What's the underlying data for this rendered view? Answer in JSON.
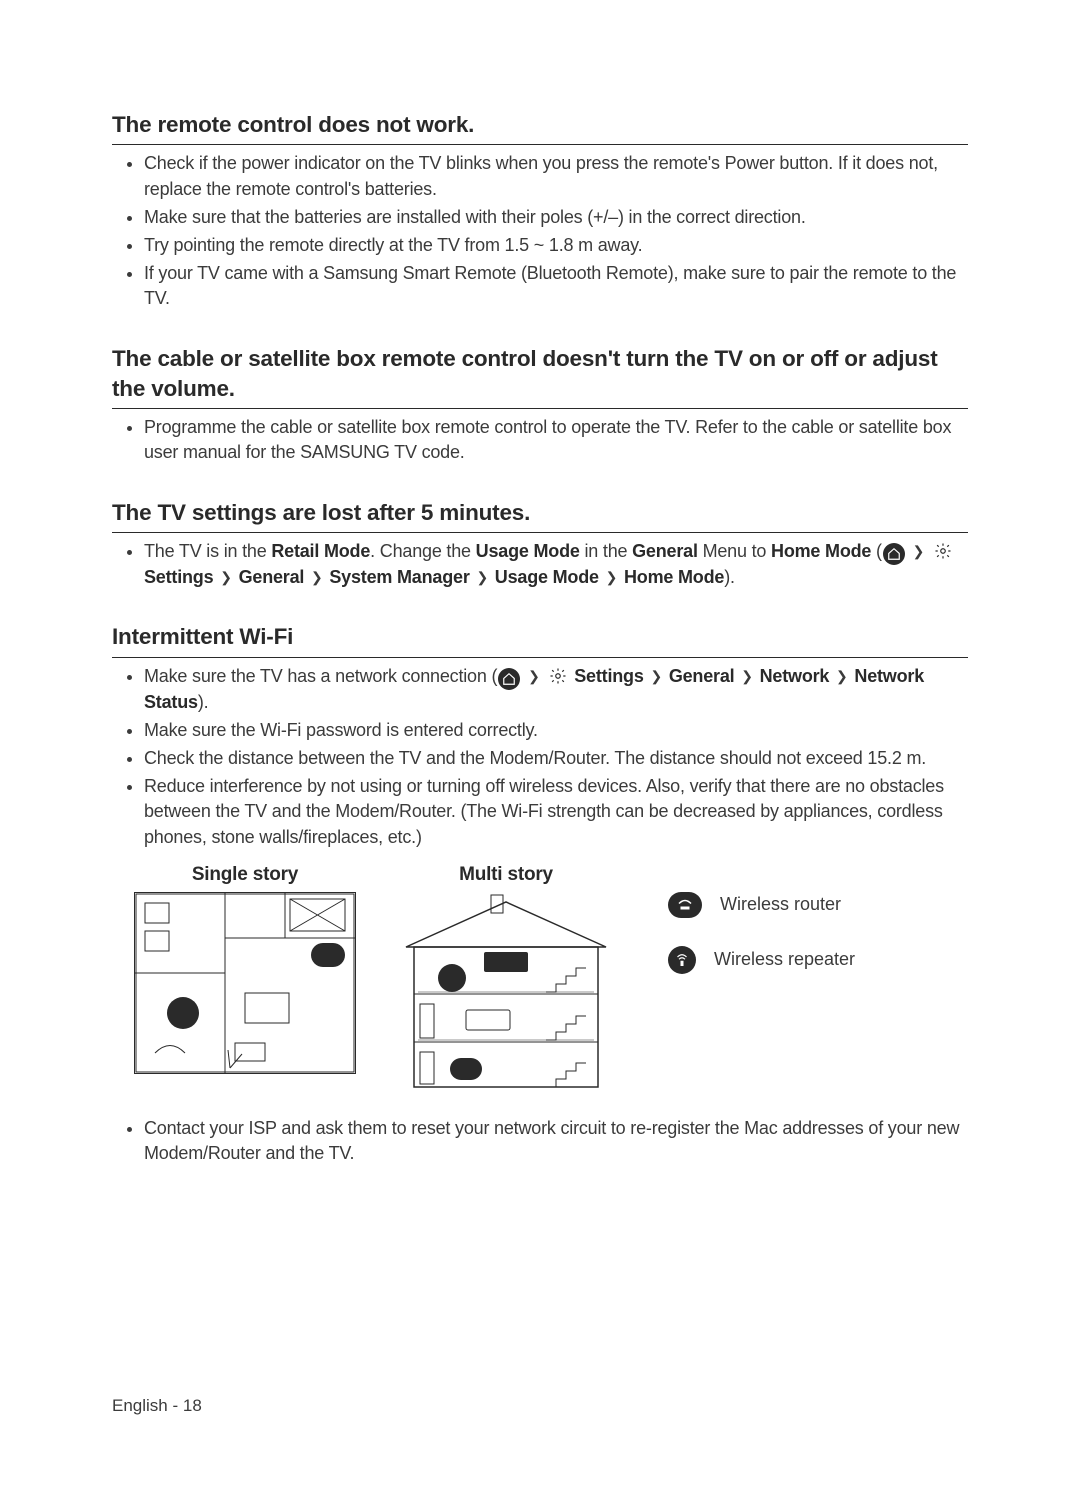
{
  "sections": [
    {
      "heading": "The remote control does not work.",
      "items": [
        {
          "text": "Check if the power indicator on the TV blinks when you press the remote's Power button. If it does not, replace the remote control's batteries."
        },
        {
          "text": "Make sure that the batteries are installed with their poles (+/–) in the correct direction."
        },
        {
          "text": "Try pointing the remote directly at the TV from 1.5 ~ 1.8 m away."
        },
        {
          "text": "If your TV came with a Samsung Smart Remote (Bluetooth Remote), make sure to pair the remote to the TV."
        }
      ]
    },
    {
      "heading": "The cable or satellite box remote control doesn't turn the TV on or off or adjust the volume.",
      "items": [
        {
          "text": "Programme the cable or satellite box remote control to operate the TV. Refer to the cable or satellite box user manual for the SAMSUNG TV code."
        }
      ]
    },
    {
      "heading": "The TV settings are lost after 5 minutes.",
      "retail": {
        "prefix": "The TV is in the ",
        "retail_mode": "Retail Mode",
        "mid1": ". Change the ",
        "usage_mode": "Usage Mode",
        "mid2": " in the ",
        "general": "General",
        "mid3": " Menu to ",
        "home_mode": "Home Mode",
        "open_paren": " (",
        "settings": "Settings",
        "general2": "General",
        "system_manager": "System Manager",
        "usage_mode2": "Usage Mode",
        "home_mode2": "Home Mode",
        "close_paren": ")."
      }
    },
    {
      "heading": "Intermittent Wi-Fi",
      "wifi_conn": {
        "prefix": "Make sure the TV has a network connection (",
        "settings": "Settings",
        "general": "General",
        "network": "Network",
        "network_status": "Network Status",
        "suffix": ")."
      },
      "items_rest": [
        "Make sure the Wi-Fi password is entered correctly.",
        "Check the distance between the TV and the Modem/Router. The distance should not exceed 15.2 m.",
        "Reduce interference by not using or turning off wireless devices. Also, verify that there are no obstacles between the TV and the Modem/Router. (The Wi-Fi strength can be decreased by appliances, cordless phones, stone walls/fireplaces, etc.)"
      ],
      "diagrams": {
        "single": "Single story",
        "multi": "Multi story",
        "router": "Wireless router",
        "repeater": "Wireless repeater"
      },
      "last_item": "Contact your ISP and ask them to reset your network circuit to re-register the Mac addresses of your new Modem/Router and the TV."
    }
  ],
  "footer": {
    "lang": "English",
    "sep": " - ",
    "page": "18"
  }
}
